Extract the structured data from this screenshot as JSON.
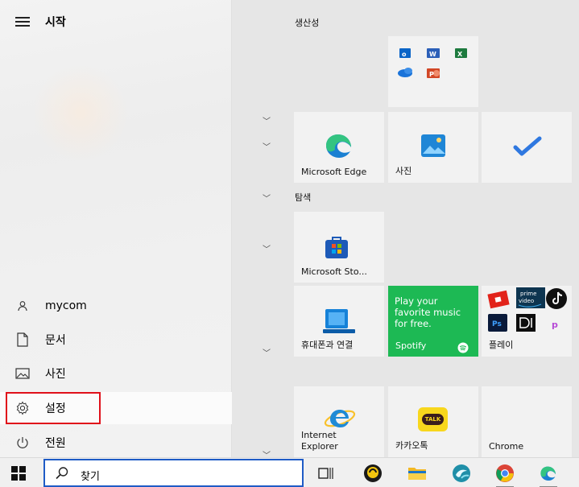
{
  "start": {
    "title": "시작"
  },
  "nav": {
    "user": "mycom",
    "documents": "문서",
    "pictures": "사진",
    "settings": "설정",
    "power": "전원"
  },
  "groups": {
    "productivity": "생산성",
    "explore": "탐색"
  },
  "tiles": {
    "edge": "Microsoft Edge",
    "photos": "사진",
    "store": "Microsoft Sto...",
    "phone": "휴대폰과 연결",
    "spotify_promo": "Play your favorite music for free.",
    "spotify": "Spotify",
    "play": "플레이",
    "ie_line1": "Internet",
    "ie_line2": "Explorer",
    "kakao": "카카오톡",
    "kakao_badge": "TALK",
    "chrome": "Chrome"
  },
  "office_apps": [
    "outlook-icon",
    "word-icon",
    "excel-icon",
    "onedrive-icon",
    "powerpoint-icon"
  ],
  "play_apps": [
    "roblox-icon",
    "prime-video-icon",
    "tiktok-icon",
    "photoshop-icon",
    "dolby-icon",
    "picsart-icon"
  ],
  "play_badges": {
    "prime": "prime video",
    "ps": "Ps"
  },
  "taskbar": {
    "search_text": "찾기"
  },
  "colors": {
    "highlight": "#e0101a",
    "spotify": "#1ed760",
    "search_border": "#1f5bc6"
  }
}
